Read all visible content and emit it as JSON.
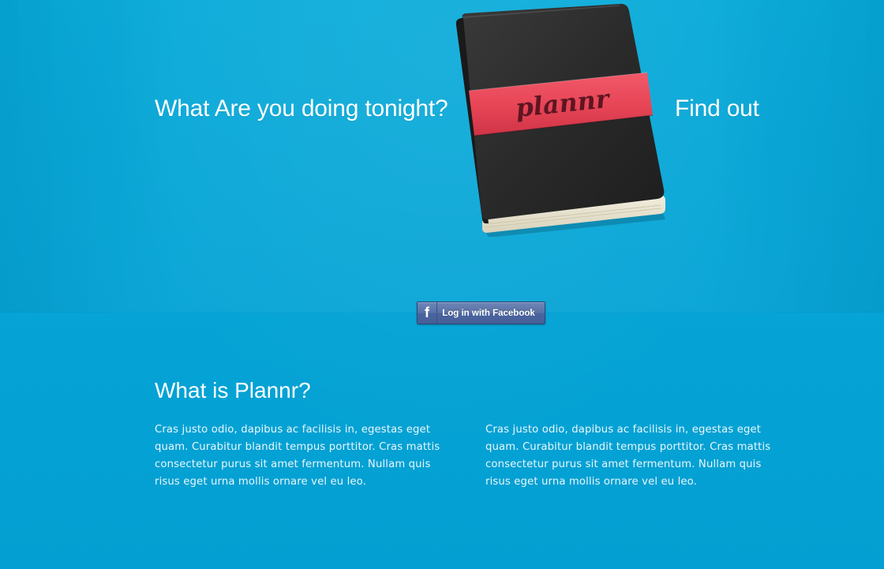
{
  "hero": {
    "tagline_left": "What Are you doing tonight?",
    "tagline_right": "Find out",
    "logo_text": "plannr"
  },
  "login": {
    "icon_glyph": "f",
    "label": "Log in with Facebook"
  },
  "about": {
    "title": "What is Plannr?",
    "paragraphs": [
      "Cras justo odio, dapibus ac facilisis in, egestas eget quam. Curabitur blandit tempus porttitor. Cras mattis consectetur purus sit amet fermentum. Nullam quis risus eget urna mollis ornare vel eu leo.",
      "Cras justo odio, dapibus ac facilisis in, egestas eget quam. Curabitur blandit tempus porttitor. Cras mattis consectetur purus sit amet fermentum. Nullam quis risus eget urna mollis ornare vel eu leo."
    ]
  },
  "colors": {
    "background": "#05a4d6",
    "notebook_cover": "#2b2b2b",
    "band": "#e8485a",
    "facebook": "#4a64a0",
    "text": "#ffffff"
  },
  "icons": {
    "notebook": "notebook-icon",
    "facebook": "facebook-icon"
  }
}
